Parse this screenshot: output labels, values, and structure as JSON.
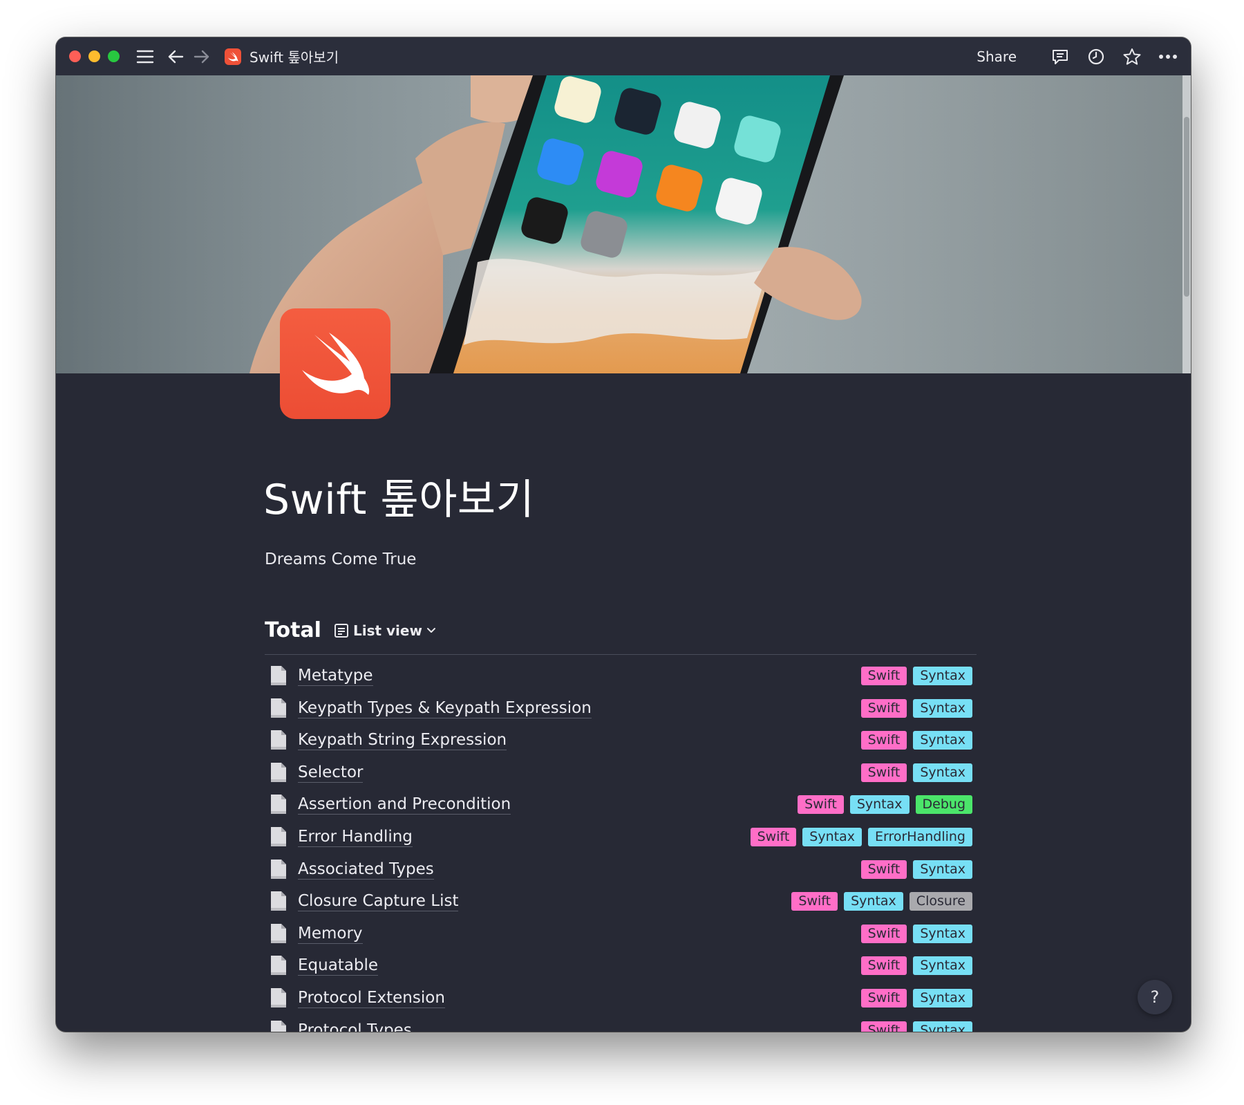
{
  "titlebar": {
    "title": "Swift 톺아보기",
    "share_label": "Share",
    "icons": [
      "menu-icon",
      "arrow-left-icon",
      "arrow-right-icon",
      "comment-icon",
      "clock-icon",
      "star-icon",
      "more-icon"
    ]
  },
  "page": {
    "title": "Swift 톺아보기",
    "description": "Dreams Come True",
    "icon": "swift-logo-icon",
    "cover": "hand-holding-iphone-photo",
    "accent": "#ef5138"
  },
  "database": {
    "title": "Total",
    "view_label": "List view",
    "tag_colors": {
      "Swift": "#ff6ec7",
      "Syntax": "#77dff5",
      "Debug": "#4be56a",
      "ErrorHandling": "#77dff5",
      "Closure": "#a9a9ad"
    },
    "rows": [
      {
        "title": "Metatype",
        "tags": [
          "Swift",
          "Syntax"
        ]
      },
      {
        "title": "Keypath Types & Keypath Expression",
        "tags": [
          "Swift",
          "Syntax"
        ]
      },
      {
        "title": "Keypath String Expression",
        "tags": [
          "Swift",
          "Syntax"
        ]
      },
      {
        "title": "Selector",
        "tags": [
          "Swift",
          "Syntax"
        ]
      },
      {
        "title": "Assertion and Precondition",
        "tags": [
          "Swift",
          "Syntax",
          "Debug"
        ]
      },
      {
        "title": "Error Handling",
        "tags": [
          "Swift",
          "Syntax",
          "ErrorHandling"
        ]
      },
      {
        "title": "Associated Types",
        "tags": [
          "Swift",
          "Syntax"
        ]
      },
      {
        "title": "Closure Capture List",
        "tags": [
          "Swift",
          "Syntax",
          "Closure"
        ]
      },
      {
        "title": "Memory",
        "tags": [
          "Swift",
          "Syntax"
        ]
      },
      {
        "title": "Equatable",
        "tags": [
          "Swift",
          "Syntax"
        ]
      },
      {
        "title": "Protocol Extension",
        "tags": [
          "Swift",
          "Syntax"
        ]
      },
      {
        "title": "Protocol Types",
        "tags": [
          "Swift",
          "Syntax"
        ]
      }
    ]
  },
  "help": {
    "label": "?"
  }
}
